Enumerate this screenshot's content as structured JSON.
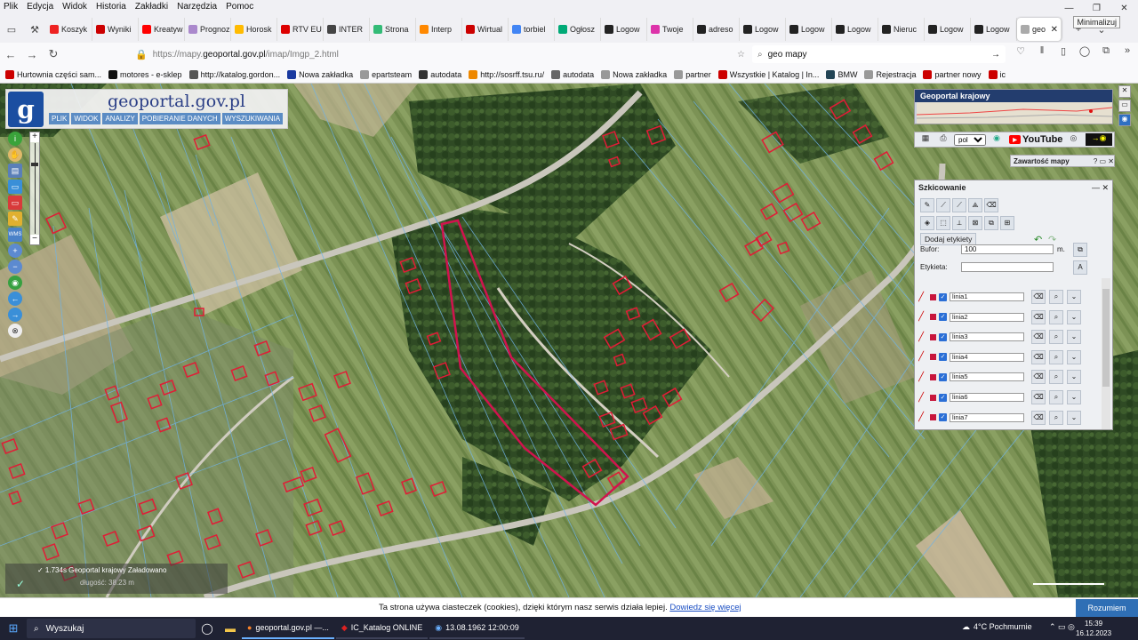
{
  "menubar": {
    "items": [
      "Plik",
      "Edycja",
      "Widok",
      "Historia",
      "Zakładki",
      "Narzędzia",
      "Pomoc"
    ]
  },
  "window": {
    "minimize_tooltip": "Minimalizuj"
  },
  "tabs": [
    {
      "label": "Koszyk",
      "color": "#e22"
    },
    {
      "label": "Wyniki",
      "color": "#c00"
    },
    {
      "label": "Kreatyw OCTWA",
      "color": "#f00"
    },
    {
      "label": "Prognoz",
      "color": "#a8c"
    },
    {
      "label": "Horosk",
      "color": "#fb0"
    },
    {
      "label": "RTV EU",
      "color": "#d00"
    },
    {
      "label": "INTER",
      "color": "#444"
    },
    {
      "label": "Strona",
      "color": "#3b7"
    },
    {
      "label": "Interp",
      "color": "#f80"
    },
    {
      "label": "Wirtual",
      "color": "#c00"
    },
    {
      "label": "torbiel",
      "color": "#4285f4"
    },
    {
      "label": "Ogłosz",
      "color": "#0a7"
    },
    {
      "label": "Logow",
      "color": "#222"
    },
    {
      "label": "Twoje",
      "color": "#d3a"
    },
    {
      "label": "adreso",
      "color": "#222"
    },
    {
      "label": "Logow",
      "color": "#222"
    },
    {
      "label": "Logow",
      "color": "#222"
    },
    {
      "label": "Logow",
      "color": "#222"
    },
    {
      "label": "Nieruc",
      "color": "#222"
    },
    {
      "label": "Logow",
      "color": "#222"
    },
    {
      "label": "Logow",
      "color": "#222"
    },
    {
      "label": "geo",
      "color": "#aaa",
      "active": true
    }
  ],
  "nav": {
    "url_prefix": "https://mapy.",
    "url_domain": "geoportal.gov.pl",
    "url_suffix": "/imap/Imgp_2.html",
    "search_value": "geo mapy"
  },
  "bookmarks": [
    {
      "label": "Hurtownia części sam...",
      "color": "#c00"
    },
    {
      "label": "motores - e-sklep",
      "color": "#111"
    },
    {
      "label": "http://katalog.gordon...",
      "color": "#555"
    },
    {
      "label": "Nowa zakładka",
      "color": "#1a3aa0"
    },
    {
      "label": "epartsteam",
      "color": "#999"
    },
    {
      "label": "autodata",
      "color": "#333"
    },
    {
      "label": "http://sosrff.tsu.ru/",
      "color": "#e80"
    },
    {
      "label": "autodata",
      "color": "#666"
    },
    {
      "label": "Nowa zakładka",
      "color": "#999"
    },
    {
      "label": "partner",
      "color": "#999"
    },
    {
      "label": "Wszystkie | Katalog | In...",
      "color": "#c00"
    },
    {
      "label": "BMW",
      "color": "#245"
    },
    {
      "label": "Rejestracja",
      "color": "#999"
    },
    {
      "label": "partner nowy",
      "color": "#c00"
    },
    {
      "label": "ic",
      "color": "#c00"
    }
  ],
  "logo": {
    "letter": "g",
    "title": "geoportal.gov.pl",
    "menu": [
      "PLIK",
      "WIDOK",
      "ANALIZY",
      "POBIERANIE DANYCH",
      "WYSZUKIWANIA"
    ]
  },
  "geoportal_krajowy": {
    "title": "Geoportal krajowy"
  },
  "toolbar_right": {
    "lang": "pol",
    "youtube": "YouTube"
  },
  "zawartosc": {
    "title": "Zawartość mapy",
    "controls": "? ▭ ✕"
  },
  "szkicowanie": {
    "title": "Szkicowanie",
    "add_labels": "Dodaj etykiety",
    "bufor_label": "Bufor:",
    "bufor_value": "100",
    "bufor_unit": "m.",
    "etykieta_label": "Etykieta:",
    "etykieta_value": "",
    "lines": [
      "linia1",
      "linia2",
      "linia3",
      "linia4",
      "linia5",
      "linia6",
      "linia7"
    ]
  },
  "status": {
    "line1": "✓ 1.734s   Geoportal krajowy   Załadowano",
    "line2": "długość: 38.23 m"
  },
  "cookie": {
    "text": "Ta strona używa ciasteczek (cookies), dzięki którym nasz serwis działa lepiej.",
    "link": "Dowiedz się więcej",
    "button": "Rozumiem"
  },
  "taskbar": {
    "search": "Wyszukaj",
    "tasks": [
      "geoportal.gov.pl —...",
      "IC_Katalog ONLINE",
      "13.08.1962 12:00:09"
    ],
    "weather": "4°C  Pochmurnie",
    "time": "15:39",
    "date": "16.12.2023"
  }
}
